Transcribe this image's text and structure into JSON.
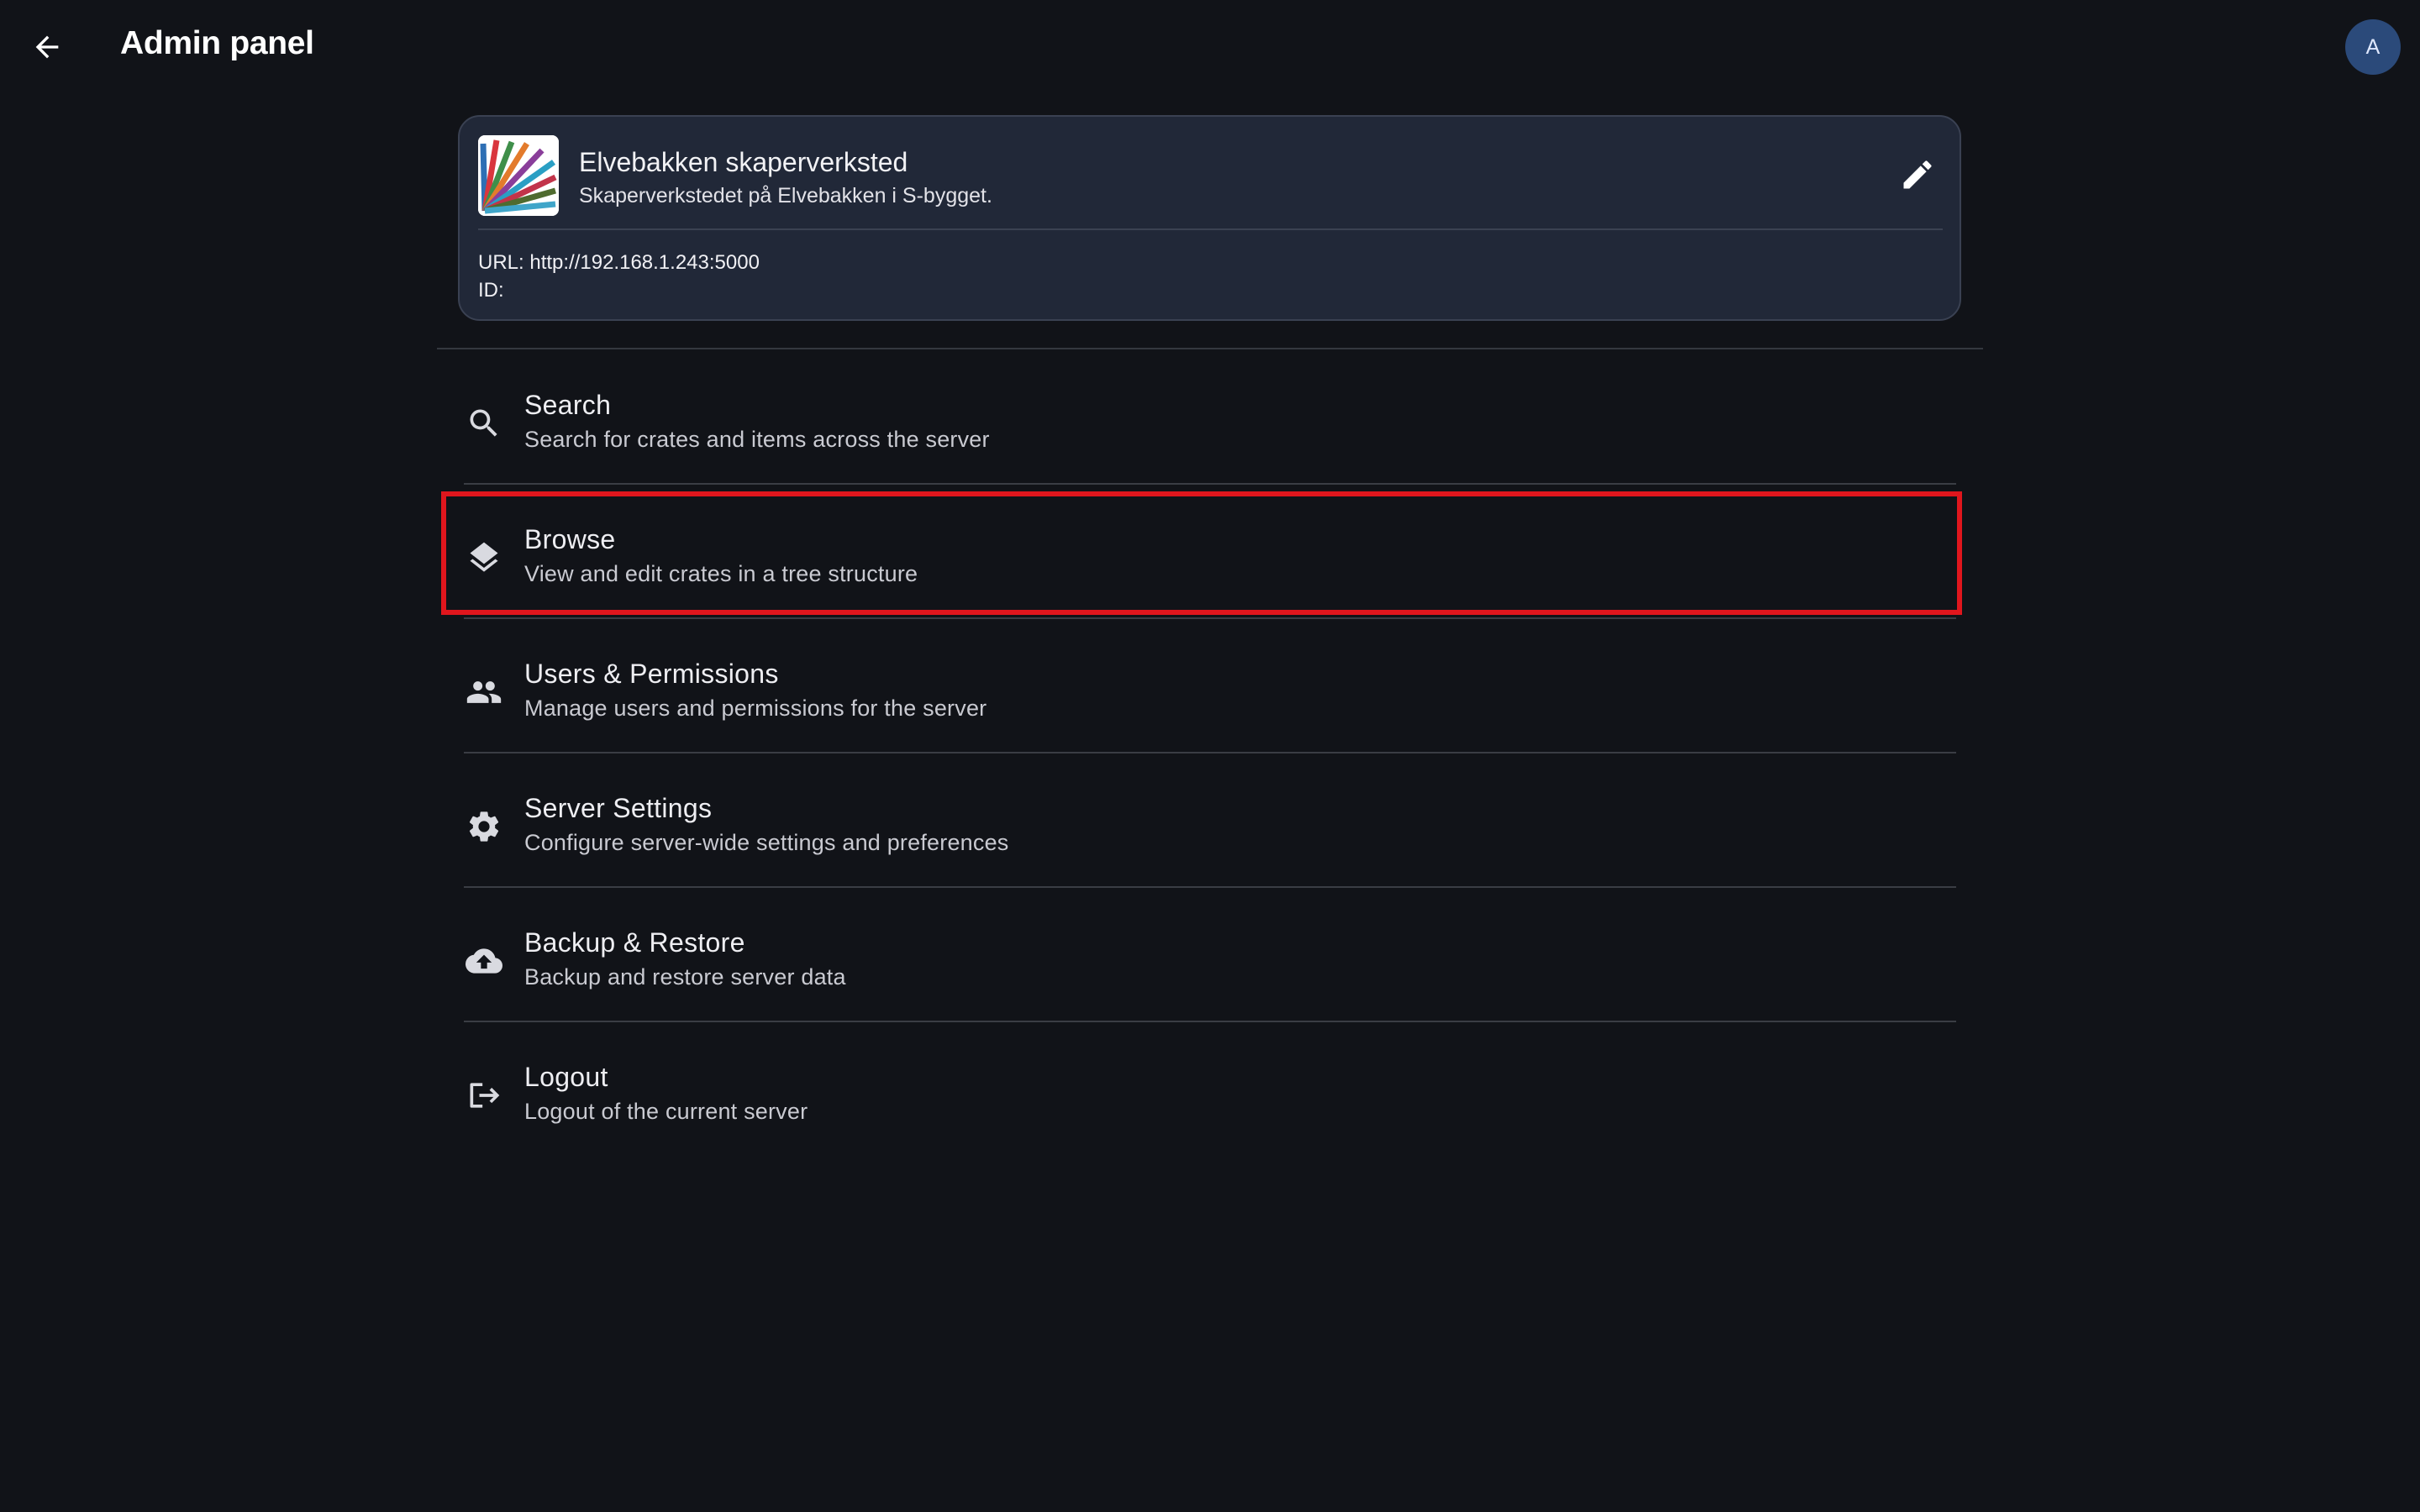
{
  "app_bar": {
    "title": "Admin panel",
    "avatar_initial": "A",
    "back_icon": "arrow-left-icon"
  },
  "server_card": {
    "name": "Elvebakken skaperverksted",
    "description": "Skaperverkstedet på Elvebakken i S-bygget.",
    "url_line": "URL: http://192.168.1.243:5000",
    "id_line": "ID:",
    "edit_icon": "pencil-icon"
  },
  "menu": {
    "items": [
      {
        "label": "Search",
        "description": "Search for crates and items across the server",
        "icon": "search-icon"
      },
      {
        "label": "Browse",
        "description": "View and edit crates in a tree structure",
        "icon": "layers-icon"
      },
      {
        "label": "Users & Permissions",
        "description": "Manage users and permissions for the server",
        "icon": "people-icon"
      },
      {
        "label": "Server Settings",
        "description": "Configure server-wide settings and preferences",
        "icon": "gear-icon"
      },
      {
        "label": "Backup & Restore",
        "description": "Backup and restore server data",
        "icon": "cloud-upload-icon"
      },
      {
        "label": "Logout",
        "description": "Logout of the current server",
        "icon": "logout-icon"
      }
    ],
    "highlighted_item": "Browse"
  },
  "colors": {
    "background": "#111318",
    "card": "#212838",
    "avatar": "#2b4a7a",
    "highlight": "#e0161d"
  }
}
